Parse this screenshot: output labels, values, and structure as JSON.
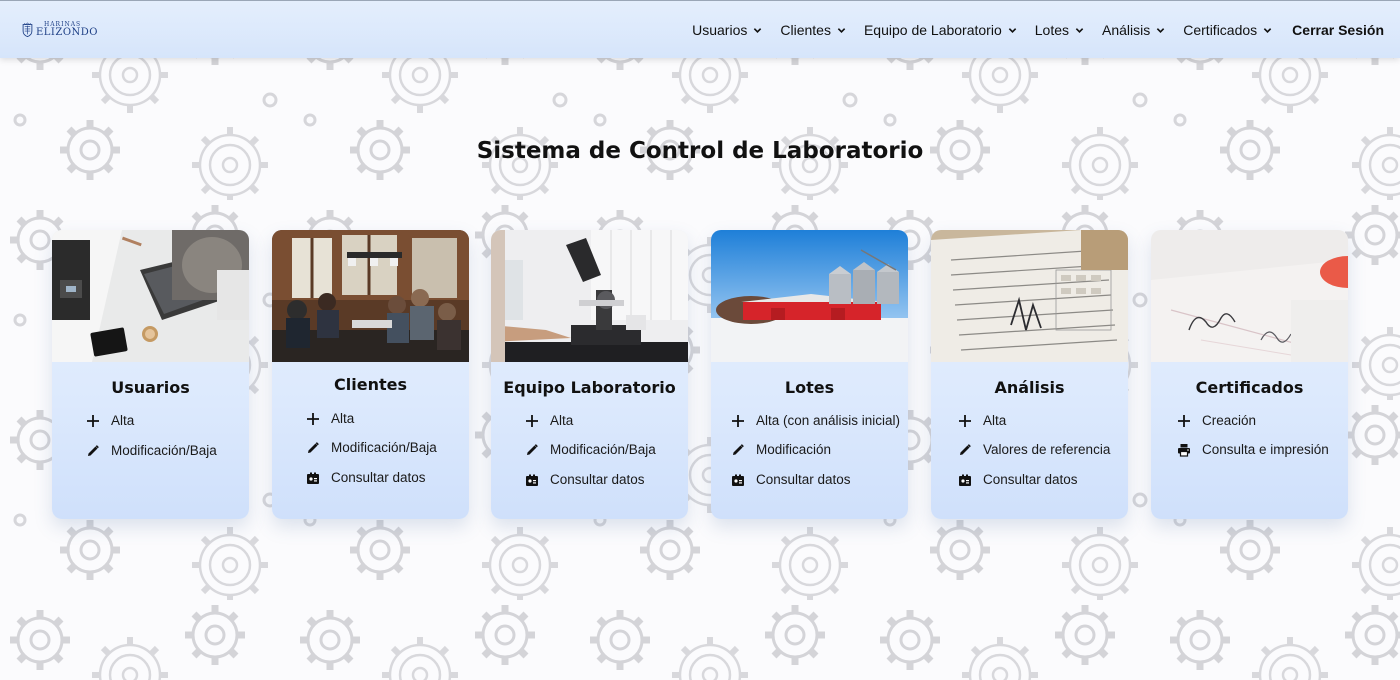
{
  "brand": {
    "small": "HARINAS",
    "big": "ELIZONDO"
  },
  "nav": {
    "items": [
      {
        "label": "Usuarios"
      },
      {
        "label": "Clientes"
      },
      {
        "label": "Equipo de Laboratorio"
      },
      {
        "label": "Lotes"
      },
      {
        "label": "Análisis"
      },
      {
        "label": "Certificados"
      }
    ],
    "logout": "Cerrar Sesión"
  },
  "page": {
    "title": "Sistema de Control de Laboratorio"
  },
  "colors": {
    "accent_card": "#dce9fd",
    "navbar": "#dde9fb",
    "barn_red": "#d6242a"
  },
  "cards": [
    {
      "title": "Usuarios",
      "image": "office-laptop-photo",
      "items": [
        {
          "icon": "plus-icon",
          "label": "Alta"
        },
        {
          "icon": "pencil-icon",
          "label": "Modificación/Baja"
        }
      ]
    },
    {
      "title": "Clientes",
      "image": "meeting-room-photo",
      "items": [
        {
          "icon": "plus-icon",
          "label": "Alta"
        },
        {
          "icon": "pencil-icon",
          "label": "Modificación/Baja"
        },
        {
          "icon": "id-card-icon",
          "label": "Consultar datos"
        }
      ]
    },
    {
      "title": "Equipo Laboratorio",
      "image": "microscope-photo",
      "items": [
        {
          "icon": "plus-icon",
          "label": "Alta"
        },
        {
          "icon": "pencil-icon",
          "label": "Modificación/Baja"
        },
        {
          "icon": "id-card-icon",
          "label": "Consultar datos"
        }
      ]
    },
    {
      "title": "Lotes",
      "image": "red-barn-silos-photo",
      "items": [
        {
          "icon": "plus-icon",
          "label": "Alta (con análisis inicial)"
        },
        {
          "icon": "pencil-icon",
          "label": "Modificación"
        },
        {
          "icon": "id-card-icon",
          "label": "Consultar datos"
        }
      ]
    },
    {
      "title": "Análisis",
      "image": "lab-report-paper-photo",
      "items": [
        {
          "icon": "plus-icon",
          "label": "Alta"
        },
        {
          "icon": "pencil-icon",
          "label": "Valores de referencia"
        },
        {
          "icon": "id-card-icon",
          "label": "Consultar datos"
        }
      ]
    },
    {
      "title": "Certificados",
      "image": "signed-certificate-photo",
      "items": [
        {
          "icon": "plus-icon",
          "label": "Creación"
        },
        {
          "icon": "printer-icon",
          "label": "Consulta e impresión"
        }
      ]
    }
  ]
}
